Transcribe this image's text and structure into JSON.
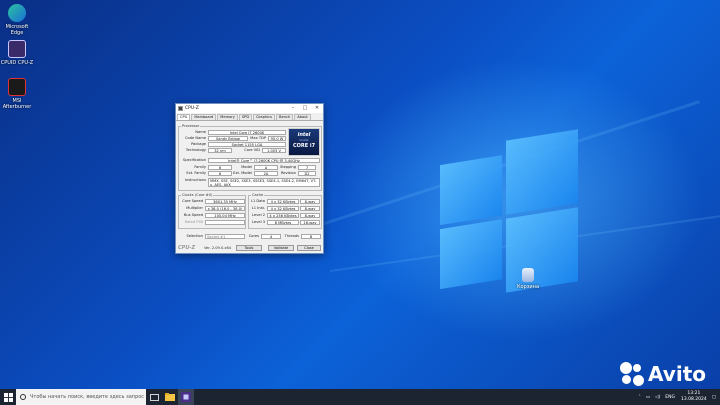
{
  "desktop": {
    "icons": [
      {
        "label": "Microsoft Edge"
      },
      {
        "label": "CPUID CPU-Z"
      },
      {
        "label": "MSI Afterburner"
      }
    ],
    "recycle_bin": {
      "label": "Корзина"
    }
  },
  "cpuz": {
    "title": "CPU-Z",
    "tabs": [
      "CPU",
      "Mainboard",
      "Memory",
      "SPD",
      "Graphics",
      "Bench",
      "About"
    ],
    "processor": {
      "group_title": "Processor",
      "name_label": "Name",
      "name": "Intel Core i7 2600K",
      "codename_label": "Code Name",
      "codename": "Sandy Bridge",
      "maxtdp_label": "Max TDP",
      "maxtdp": "95.0 W",
      "package_label": "Package",
      "package": "Socket 1155 LGA",
      "technology_label": "Technology",
      "technology": "32 nm",
      "corevid_label": "Core VID",
      "corevid": "1.003 V",
      "spec_label": "Specification",
      "spec": "Intel® Core™ i7-2600K CPU @ 3.40GHz",
      "family_label": "Family",
      "family": "6",
      "model_label": "Model",
      "model": "A",
      "stepping_label": "Stepping",
      "stepping": "7",
      "extfamily_label": "Ext. Family",
      "extfamily": "6",
      "extmodel_label": "Ext. Model",
      "extmodel": "2A",
      "revision_label": "Revision",
      "revision": "D2",
      "instr_label": "Instructions",
      "instructions": "MMX, SSE, SSE2, SSE3, SSSE3, SSE4.1, SSE4.2, EM64T, VT-x, AES, AVX",
      "badge_brand": "intel",
      "badge_line": "inside",
      "badge_model": "CORE i7"
    },
    "clocks": {
      "group_title": "Clocks (Core #0)",
      "corespeed_label": "Core Speed",
      "corespeed": "3601.35 MHz",
      "multiplier_label": "Multiplier",
      "multiplier": "x 36.0 (16.0 - 38.0)",
      "busspeed_label": "Bus Speed",
      "busspeed": "100.04 MHz",
      "ratedfsb_label": "Rated FSB",
      "ratedfsb": ""
    },
    "cache": {
      "group_title": "Cache",
      "l1d_label": "L1 Data",
      "l1d": "4 x 32 KBytes",
      "l1d_way": "8-way",
      "l1i_label": "L1 Inst.",
      "l1i": "4 x 32 KBytes",
      "l1i_way": "8-way",
      "l2_label": "Level 2",
      "l2": "4 x 256 KBytes",
      "l2_way": "8-way",
      "l3_label": "Level 3",
      "l3": "8 MBytes",
      "l3_way": "16-way"
    },
    "footer": {
      "selection_label": "Selection",
      "selection": "Socket #1",
      "cores_label": "Cores",
      "cores": "4",
      "threads_label": "Threads",
      "threads": "8",
      "brand": "CPU-Z",
      "version": "Ver. 2.09.0.x64",
      "tools": "Tools",
      "validate": "Validate",
      "close": "Close"
    }
  },
  "taskbar": {
    "search_placeholder": "Чтобы начать поиск, введите здесь запрос",
    "language": "ENG",
    "time": "13:21",
    "date": "13.08.2024"
  },
  "watermark": {
    "brand": "Avito"
  },
  "colors": {
    "accent": "#0c62d8",
    "taskbar": "#1c2431"
  }
}
